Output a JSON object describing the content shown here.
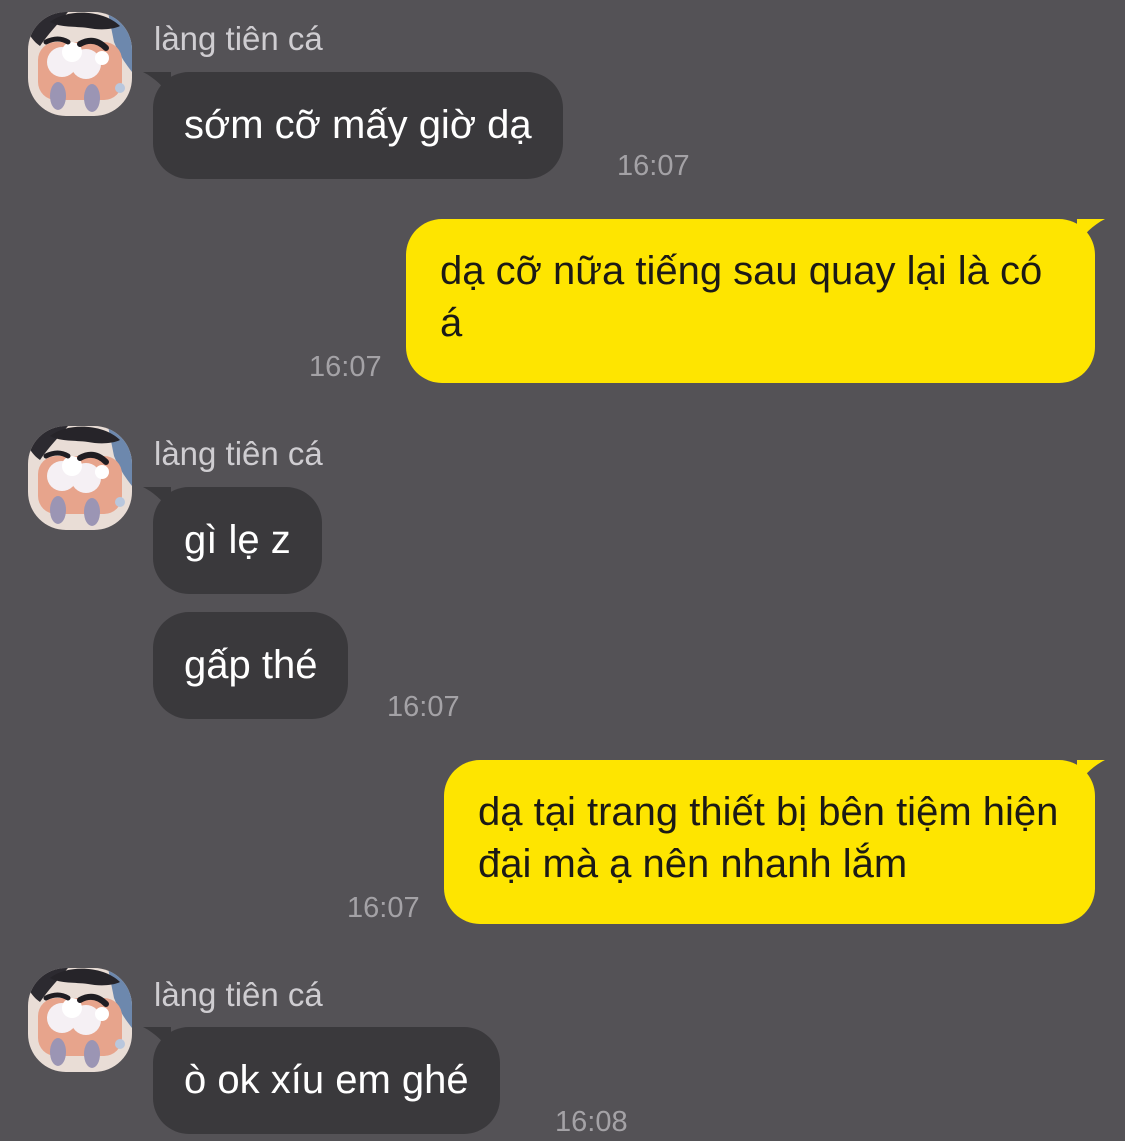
{
  "colors": {
    "background": "#545256",
    "incoming_bubble": "#3a393c",
    "outgoing_bubble": "#fee500",
    "timestamp": "#a4a2a6"
  },
  "chat": {
    "messages": [
      {
        "sender": "làng tiên cá",
        "text": "sớm cỡ mấy giờ dạ",
        "time": "16:07"
      },
      {
        "text": "dạ cỡ nữa tiếng sau quay lại là có á",
        "time": "16:07"
      },
      {
        "sender": "làng tiên cá",
        "text": "gì lẹ z"
      },
      {
        "text": "gấp thé",
        "time": "16:07"
      },
      {
        "text": "dạ tại trang thiết bị bên tiệm hiện đại mà ạ nên nhanh lắm",
        "time": "16:07"
      },
      {
        "sender": "làng tiên cá",
        "text": "ò ok xíu em ghé",
        "time": "16:08"
      }
    ]
  }
}
